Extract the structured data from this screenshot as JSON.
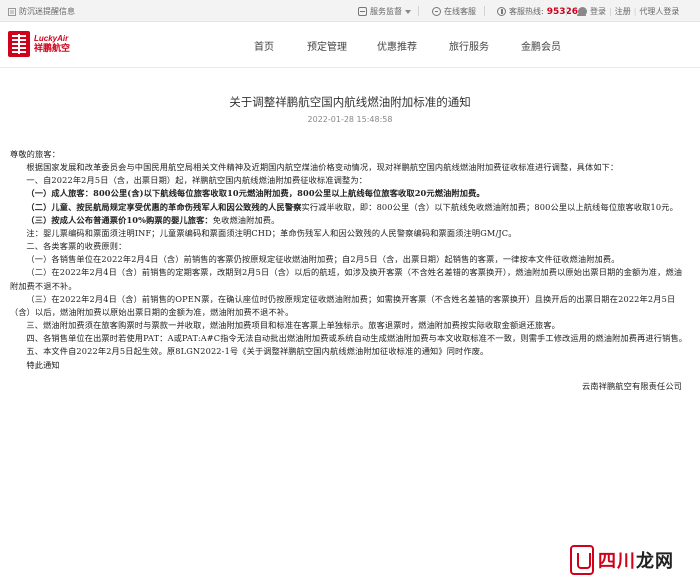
{
  "topbar": {
    "lang": "防沉迷提醒信息",
    "supervise": "服务监督",
    "chat": "在线客服",
    "hotline_label": "客服热线:",
    "hotline_number": "95326",
    "login": "登录",
    "register": "注册",
    "agent_login": "代理人登录"
  },
  "brand": {
    "en": "LuckyAir",
    "cn": "祥鹏航空"
  },
  "nav": [
    "首页",
    "预定管理",
    "优惠推荐",
    "旅行服务",
    "金鹏会员"
  ],
  "article": {
    "title": "关于调整祥鹏航空国内航线燃油附加标准的通知",
    "datetime": "2022-01-28 15:48:58",
    "greeting": "尊敬的旅客：",
    "intro": "根据国家发展和改革委员会与中国民用航空局相关文件精神及近期国内航空煤油价格变动情况，现对祥鹏航空国内航线燃油附加费征收标准进行调整，具体如下：",
    "s1_heading": "一、自2022年2月5日（含，出票日期）起，祥鹏航空国内航线燃油附加费征收标准调整为：",
    "s1_a": "（一）成人旅客：800公里(含)以下航线每位旅客收取10元燃油附加费，800公里以上航线每位旅客收取20元燃油附加费。",
    "s1_b_bold": "（二）儿童、按民航局规定享受优惠的革命伤残军人和因公致残的人民警察",
    "s1_b_rest": "实行减半收取，即：800公里（含）以下航线免收燃油附加费；800公里以上航线每位旅客收取10元。",
    "s1_c_bold": "（三）按成人公布普通票价10%购票的婴儿旅客：",
    "s1_c_rest": "免收燃油附加费。",
    "note": "注：婴儿票编码和票面须注明INF；儿童票编码和票面须注明CHD；革命伤残军人和因公致残的人民警察编码和票面须注明GM/JC。",
    "s2_heading": "二、各类客票的收费原则：",
    "s2_1": "（一）各销售单位在2022年2月4日（含）前销售的客票仍按原规定征收燃油附加费；自2月5日（含，出票日期）起销售的客票，一律按本文件征收燃油附加费。",
    "s2_2": "（二）在2022年2月4日（含）前销售的定期客票，改期到2月5日（含）以后的航班，如涉及换开客票（不含姓名差错的客票换开），燃油附加费以原始出票日期的金额为准，燃油附加费不退不补。",
    "s2_3": "（三）在2022年2月4日（含）前销售的OPEN票，在确认座位时仍按原规定征收燃油附加费；如需换开客票（不含姓名差错的客票换开）且换开后的出票日期在2022年2月5日（含）以后，燃油附加费以原始出票日期的金额为准，燃油附加费不退不补。",
    "s3": "三、燃油附加费须在旅客购票时与票款一并收取，燃油附加费项目和标准在客票上单独标示。旅客退票时，燃油附加费按实际收取金额退还旅客。",
    "s4": "四、各销售单位在出票时若使用PAT：A或PAT:A#C指令无法自动批出燃油附加费或系统自动生成燃油附加费与本文收取标准不一致，则需手工修改运用的燃油附加费再进行销售。",
    "s5": "五、本文件自2022年2月5日起生效。原8LGN2022-1号《关于调整祥鹏航空国内航线燃油附加征收标准的通知》同时作废。",
    "closing": "特此通知",
    "signature": "云南祥鹏航空有限责任公司"
  },
  "watermark": {
    "text_red": "四川",
    "text_dark": "龙网"
  }
}
